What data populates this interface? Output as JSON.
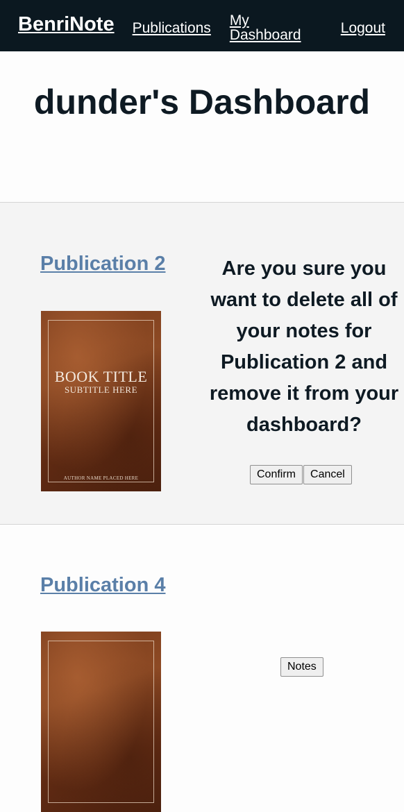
{
  "nav": {
    "brand": "BenriNote",
    "links": [
      "Publications",
      "My Dashboard",
      "Logout"
    ]
  },
  "page": {
    "title": "dunder's Dashboard"
  },
  "publications": [
    {
      "title": "Publication 2",
      "cover": {
        "title": "BOOK TITLE",
        "subtitle": "SUBTITLE HERE",
        "author": "AUTHOR NAME PLACED HERE"
      },
      "confirm_message": "Are you sure you want to delete all of your notes for Publication 2 and remove it from your dashboard?",
      "confirm_label": "Confirm",
      "cancel_label": "Cancel"
    },
    {
      "title": "Publication 4",
      "notes_label": "Notes"
    }
  ],
  "colors": {
    "navbar_bg": "#0b1820",
    "link_blue": "#5a7fa8",
    "section_bg": "#f4f4f4"
  }
}
